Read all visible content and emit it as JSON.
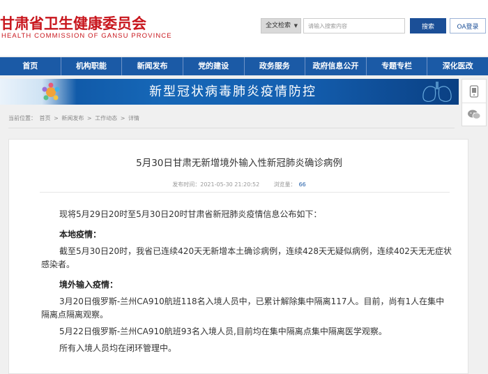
{
  "header": {
    "logo_cn": "甘肃省卫生健康委员会",
    "logo_en": "HEALTH COMMISSION OF GANSU PROVINCE",
    "search_scope": "全文检索",
    "search_placeholder": "请输入搜索内容",
    "search_button": "搜索",
    "oa_button": "OA登录"
  },
  "nav": {
    "items": [
      "首页",
      "机构职能",
      "新闻发布",
      "党的建设",
      "政务服务",
      "政府信息公开",
      "专题专栏",
      "深化医改"
    ]
  },
  "banner": {
    "title": "新型冠状病毒肺炎疫情防控"
  },
  "float_bar": {
    "icons": [
      "mobile-icon",
      "wechat-icon"
    ]
  },
  "breadcrumb": {
    "label": "当前位置：",
    "items": [
      "首页",
      "新闻发布",
      "工作动态",
      "详情"
    ],
    "separator": ">"
  },
  "article": {
    "title": "5月30日甘肃无新增境外输入性新冠肺炎确诊病例",
    "published_label": "发布时间：",
    "published": "2021-05-30 21:20:52",
    "views_label": "浏览量：",
    "views": "66",
    "intro": "现将5月29日20时至5月30日20时甘肃省新冠肺炎疫情信息公布如下：",
    "local_heading": "本地疫情：",
    "local_text": "截至5月30日20时，我省已连续420天无新增本土确诊病例，连续428天无疑似病例，连续402天无无症状感染者。",
    "imported_heading": "境外输入疫情：",
    "imported_text_1": "3月20日俄罗斯-兰州CA910航班118名入境人员中，已累计解除集中隔离117人。目前，尚有1人在集中隔离点隔离观察。",
    "imported_text_2": "5月22日俄罗斯-兰州CA910航班93名入境人员,目前均在集中隔离点集中隔离医学观察。",
    "closing": "所有入境人员均在闭环管理中。"
  }
}
